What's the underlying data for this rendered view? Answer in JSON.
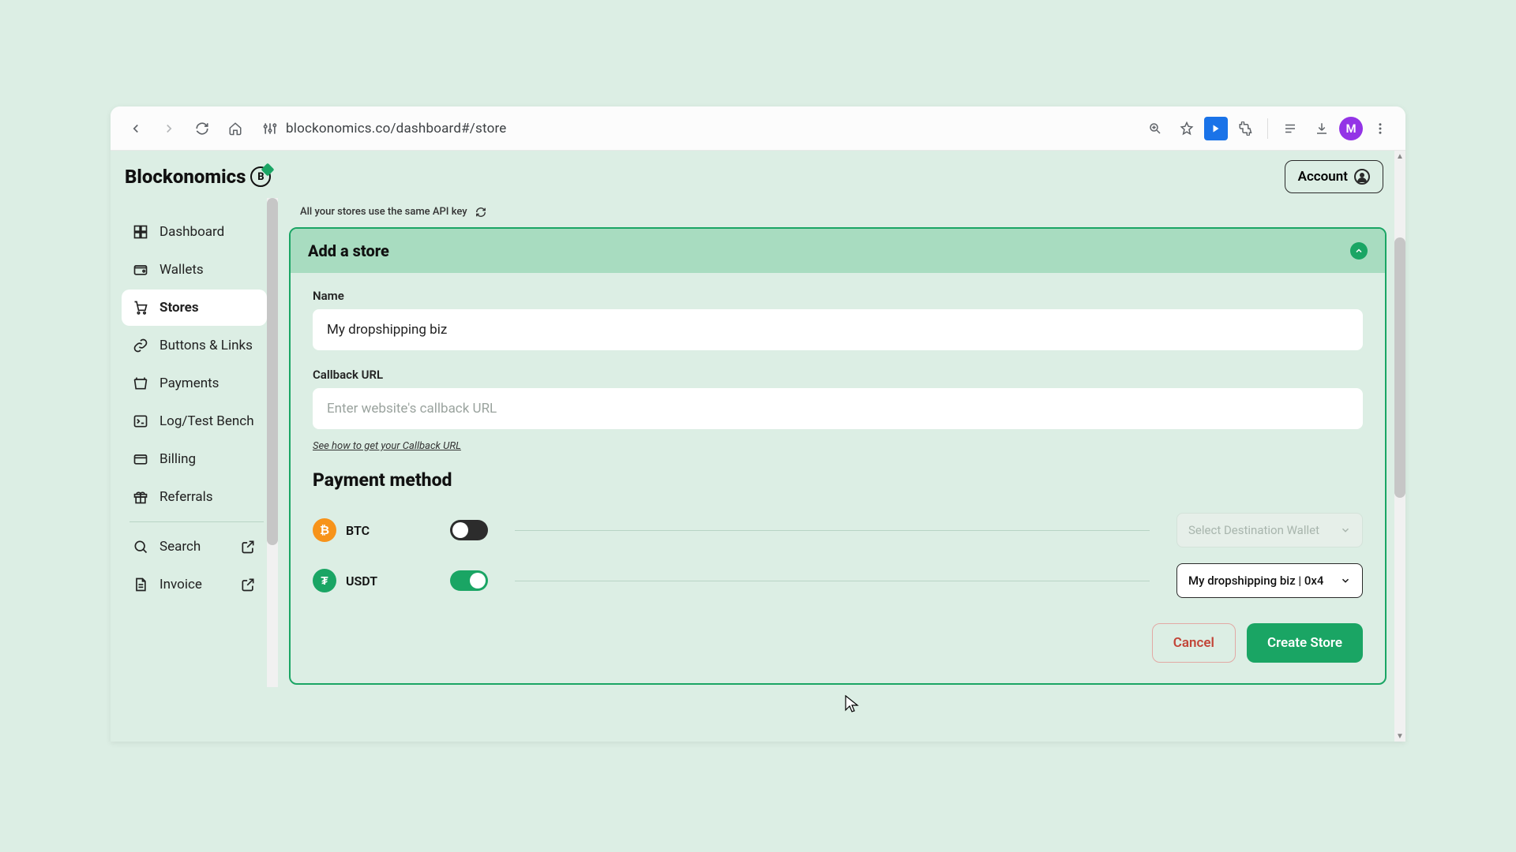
{
  "browser": {
    "url": "blockonomics.co/dashboard#/store",
    "avatar_initial": "M"
  },
  "brand": {
    "name": "Blockonomics",
    "badge": "B"
  },
  "account_button": "Account",
  "sidebar": {
    "items": [
      {
        "label": "Dashboard"
      },
      {
        "label": "Wallets"
      },
      {
        "label": "Stores"
      },
      {
        "label": "Buttons & Links"
      },
      {
        "label": "Payments"
      },
      {
        "label": "Log/Test Bench"
      },
      {
        "label": "Billing"
      },
      {
        "label": "Referrals"
      }
    ],
    "footer": [
      {
        "label": "Search"
      },
      {
        "label": "Invoice"
      }
    ]
  },
  "api_note": "All your stores use the same API key",
  "card": {
    "title": "Add a store",
    "name_label": "Name",
    "name_value": "My dropshipping biz",
    "callback_label": "Callback URL",
    "callback_placeholder": "Enter website's callback URL",
    "callback_help": "See how to get your Callback URL",
    "payment_heading": "Payment method",
    "methods": {
      "btc": {
        "label": "BTC",
        "symbol": "₿",
        "wallet_placeholder": "Select Destination Wallet"
      },
      "usdt": {
        "label": "USDT",
        "symbol": "₮",
        "wallet_selected": "My dropshipping biz | 0x4"
      }
    },
    "cancel": "Cancel",
    "create": "Create Store"
  }
}
